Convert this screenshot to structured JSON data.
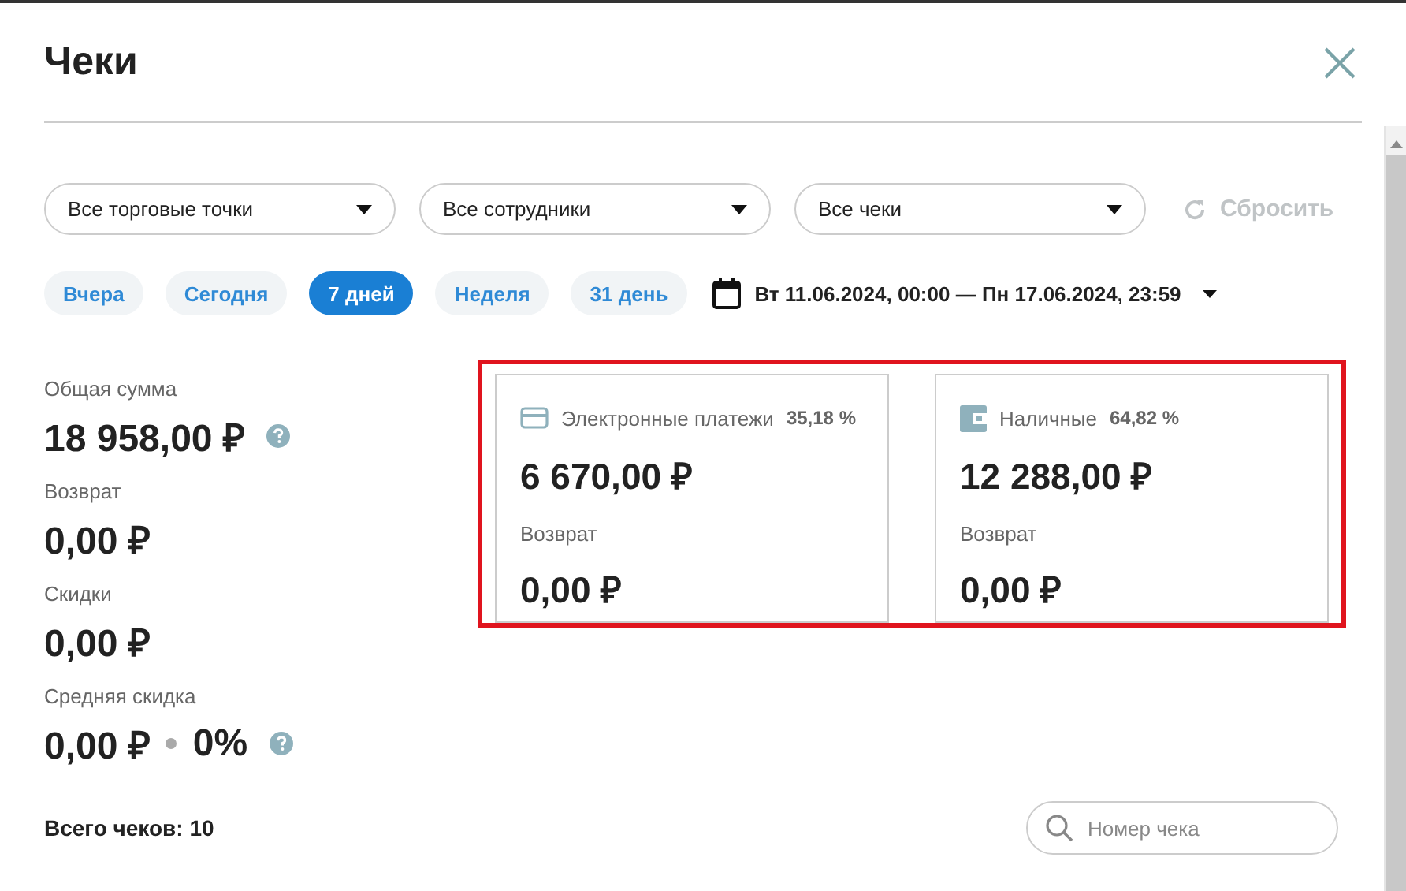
{
  "title": "Чеки",
  "filters": [
    {
      "label": "Все торговые точки"
    },
    {
      "label": "Все сотрудники"
    },
    {
      "label": "Все чеки"
    }
  ],
  "reset": {
    "label": "Сбросить",
    "disabled": true
  },
  "periods": [
    {
      "label": "Вчера",
      "selected": false
    },
    {
      "label": "Сегодня",
      "selected": false
    },
    {
      "label": "7 дней",
      "selected": true
    },
    {
      "label": "Неделя",
      "selected": false
    },
    {
      "label": "31 день",
      "selected": false
    }
  ],
  "date_range": "Вт 11.06.2024, 00:00 — Пн 17.06.2024, 23:59",
  "summary": [
    {
      "label": "Общая сумма",
      "value": "18 958,00 ₽",
      "help": true
    },
    {
      "label": "Возврат",
      "value": "0,00 ₽",
      "help": false
    },
    {
      "label": "Скидки",
      "value": "0,00 ₽",
      "help": false
    },
    {
      "label": "Средняя скидка",
      "value": "0,00 ₽",
      "extra": "0%",
      "help": true
    }
  ],
  "payments": [
    {
      "kind": "card",
      "label": "Электронные платежи",
      "percent": "35,18 %",
      "amount": "6 670,00 ₽",
      "refund_label": "Возврат",
      "refund_value": "0,00 ₽"
    },
    {
      "kind": "cash",
      "label": "Наличные",
      "percent": "64,82 %",
      "amount": "12 288,00 ₽",
      "refund_label": "Возврат",
      "refund_value": "0,00 ₽"
    }
  ],
  "total_checks": "Всего чеков: 10",
  "search": {
    "placeholder": "Номер чека"
  }
}
